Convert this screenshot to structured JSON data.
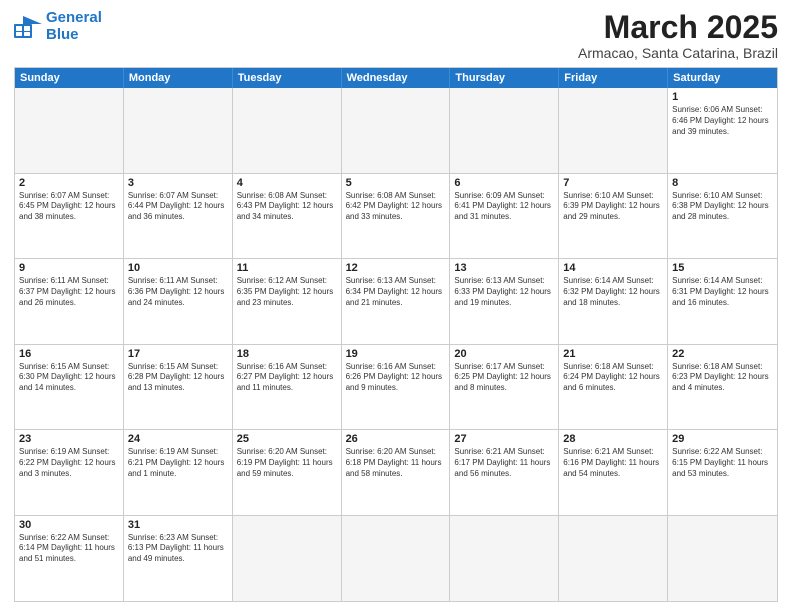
{
  "header": {
    "logo_general": "General",
    "logo_blue": "Blue",
    "main_title": "March 2025",
    "subtitle": "Armacao, Santa Catarina, Brazil"
  },
  "days_of_week": [
    "Sunday",
    "Monday",
    "Tuesday",
    "Wednesday",
    "Thursday",
    "Friday",
    "Saturday"
  ],
  "weeks": [
    [
      {
        "day": "",
        "info": ""
      },
      {
        "day": "",
        "info": ""
      },
      {
        "day": "",
        "info": ""
      },
      {
        "day": "",
        "info": ""
      },
      {
        "day": "",
        "info": ""
      },
      {
        "day": "",
        "info": ""
      },
      {
        "day": "1",
        "info": "Sunrise: 6:06 AM\nSunset: 6:46 PM\nDaylight: 12 hours and 39 minutes."
      }
    ],
    [
      {
        "day": "2",
        "info": "Sunrise: 6:07 AM\nSunset: 6:45 PM\nDaylight: 12 hours and 38 minutes."
      },
      {
        "day": "3",
        "info": "Sunrise: 6:07 AM\nSunset: 6:44 PM\nDaylight: 12 hours and 36 minutes."
      },
      {
        "day": "4",
        "info": "Sunrise: 6:08 AM\nSunset: 6:43 PM\nDaylight: 12 hours and 34 minutes."
      },
      {
        "day": "5",
        "info": "Sunrise: 6:08 AM\nSunset: 6:42 PM\nDaylight: 12 hours and 33 minutes."
      },
      {
        "day": "6",
        "info": "Sunrise: 6:09 AM\nSunset: 6:41 PM\nDaylight: 12 hours and 31 minutes."
      },
      {
        "day": "7",
        "info": "Sunrise: 6:10 AM\nSunset: 6:39 PM\nDaylight: 12 hours and 29 minutes."
      },
      {
        "day": "8",
        "info": "Sunrise: 6:10 AM\nSunset: 6:38 PM\nDaylight: 12 hours and 28 minutes."
      }
    ],
    [
      {
        "day": "9",
        "info": "Sunrise: 6:11 AM\nSunset: 6:37 PM\nDaylight: 12 hours and 26 minutes."
      },
      {
        "day": "10",
        "info": "Sunrise: 6:11 AM\nSunset: 6:36 PM\nDaylight: 12 hours and 24 minutes."
      },
      {
        "day": "11",
        "info": "Sunrise: 6:12 AM\nSunset: 6:35 PM\nDaylight: 12 hours and 23 minutes."
      },
      {
        "day": "12",
        "info": "Sunrise: 6:13 AM\nSunset: 6:34 PM\nDaylight: 12 hours and 21 minutes."
      },
      {
        "day": "13",
        "info": "Sunrise: 6:13 AM\nSunset: 6:33 PM\nDaylight: 12 hours and 19 minutes."
      },
      {
        "day": "14",
        "info": "Sunrise: 6:14 AM\nSunset: 6:32 PM\nDaylight: 12 hours and 18 minutes."
      },
      {
        "day": "15",
        "info": "Sunrise: 6:14 AM\nSunset: 6:31 PM\nDaylight: 12 hours and 16 minutes."
      }
    ],
    [
      {
        "day": "16",
        "info": "Sunrise: 6:15 AM\nSunset: 6:30 PM\nDaylight: 12 hours and 14 minutes."
      },
      {
        "day": "17",
        "info": "Sunrise: 6:15 AM\nSunset: 6:28 PM\nDaylight: 12 hours and 13 minutes."
      },
      {
        "day": "18",
        "info": "Sunrise: 6:16 AM\nSunset: 6:27 PM\nDaylight: 12 hours and 11 minutes."
      },
      {
        "day": "19",
        "info": "Sunrise: 6:16 AM\nSunset: 6:26 PM\nDaylight: 12 hours and 9 minutes."
      },
      {
        "day": "20",
        "info": "Sunrise: 6:17 AM\nSunset: 6:25 PM\nDaylight: 12 hours and 8 minutes."
      },
      {
        "day": "21",
        "info": "Sunrise: 6:18 AM\nSunset: 6:24 PM\nDaylight: 12 hours and 6 minutes."
      },
      {
        "day": "22",
        "info": "Sunrise: 6:18 AM\nSunset: 6:23 PM\nDaylight: 12 hours and 4 minutes."
      }
    ],
    [
      {
        "day": "23",
        "info": "Sunrise: 6:19 AM\nSunset: 6:22 PM\nDaylight: 12 hours and 3 minutes."
      },
      {
        "day": "24",
        "info": "Sunrise: 6:19 AM\nSunset: 6:21 PM\nDaylight: 12 hours and 1 minute."
      },
      {
        "day": "25",
        "info": "Sunrise: 6:20 AM\nSunset: 6:19 PM\nDaylight: 11 hours and 59 minutes."
      },
      {
        "day": "26",
        "info": "Sunrise: 6:20 AM\nSunset: 6:18 PM\nDaylight: 11 hours and 58 minutes."
      },
      {
        "day": "27",
        "info": "Sunrise: 6:21 AM\nSunset: 6:17 PM\nDaylight: 11 hours and 56 minutes."
      },
      {
        "day": "28",
        "info": "Sunrise: 6:21 AM\nSunset: 6:16 PM\nDaylight: 11 hours and 54 minutes."
      },
      {
        "day": "29",
        "info": "Sunrise: 6:22 AM\nSunset: 6:15 PM\nDaylight: 11 hours and 53 minutes."
      }
    ],
    [
      {
        "day": "30",
        "info": "Sunrise: 6:22 AM\nSunset: 6:14 PM\nDaylight: 11 hours and 51 minutes."
      },
      {
        "day": "31",
        "info": "Sunrise: 6:23 AM\nSunset: 6:13 PM\nDaylight: 11 hours and 49 minutes."
      },
      {
        "day": "",
        "info": ""
      },
      {
        "day": "",
        "info": ""
      },
      {
        "day": "",
        "info": ""
      },
      {
        "day": "",
        "info": ""
      },
      {
        "day": "",
        "info": ""
      }
    ]
  ]
}
